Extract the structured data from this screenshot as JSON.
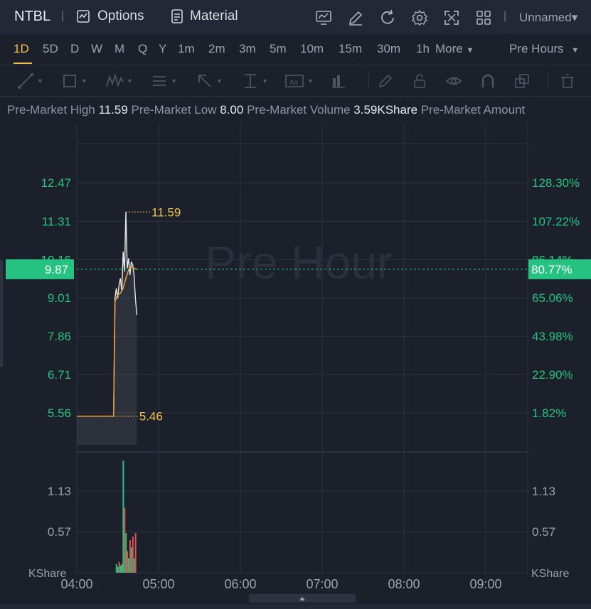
{
  "header": {
    "symbol": "NTBL",
    "separator": "|",
    "options_label": "Options",
    "material_label": "Material",
    "workspace_label": "Unnamed",
    "caret": "▾"
  },
  "periods": {
    "items": [
      "1D",
      "5D",
      "D",
      "W",
      "M",
      "Q",
      "Y",
      "1m",
      "2m",
      "3m",
      "5m",
      "10m",
      "15m",
      "30m",
      "1h"
    ],
    "active": "1D",
    "more_label": "More",
    "session_label": "Pre Hours"
  },
  "info": {
    "high_label": "Pre-Market High",
    "high_value": "11.59",
    "low_label": "Pre-Market Low",
    "low_value": "8.00",
    "volume_label": "Pre-Market Volume",
    "volume_value": "3.59KShare",
    "amount_label": "Pre-Market Amount"
  },
  "chart": {
    "watermark": "Pre Hour",
    "current_price": "9.87",
    "current_pct": "80.77%",
    "hidden_tick_left": "10.16",
    "hidden_tick_right": "86.14%",
    "high_marker": "11.59",
    "low_marker": "5.46",
    "volume_unit": "KShare"
  },
  "colors": {
    "up": "#26c281",
    "down": "#e0524f",
    "accent": "#f2c14a",
    "avg_line": "#e89a3c",
    "price_line": "#e6e6e6",
    "grid": "#2d3340"
  },
  "chart_data": {
    "type": "line",
    "x_ticks": [
      "04:00",
      "05:00",
      "06:00",
      "07:00",
      "08:00",
      "09:00"
    ],
    "price_axis": {
      "ticks": [
        12.47,
        11.31,
        10.16,
        9.01,
        7.86,
        6.71,
        5.56
      ],
      "tick_labels": [
        "12.47",
        "11.31",
        "10.16",
        "9.01",
        "7.86",
        "6.71",
        "5.56"
      ],
      "pct_labels": [
        "128.30%",
        "107.22%",
        "86.14%",
        "65.06%",
        "43.98%",
        "22.90%",
        "1.82%"
      ]
    },
    "volume_axis": {
      "ticks": [
        1.13,
        0.57
      ],
      "tick_labels": [
        "1.13",
        "0.57"
      ],
      "unit": "KShare"
    },
    "price_series": {
      "time": [
        "04:00",
        "04:20",
        "04:27",
        "04:28",
        "04:29",
        "04:30",
        "04:31",
        "04:32",
        "04:33",
        "04:34",
        "04:35",
        "04:36",
        "04:37",
        "04:38",
        "04:39",
        "04:40",
        "04:41",
        "04:42",
        "04:43",
        "04:44"
      ],
      "price": [
        5.46,
        5.46,
        5.46,
        9.0,
        9.3,
        9.0,
        9.4,
        9.6,
        9.2,
        10.4,
        9.8,
        11.59,
        9.9,
        10.2,
        9.7,
        10.1,
        10.0,
        9.7,
        9.0,
        8.5
      ]
    },
    "avg_series": {
      "time": [
        "04:00",
        "04:20",
        "04:27",
        "04:28",
        "04:30",
        "04:32",
        "04:34",
        "04:36",
        "04:38",
        "04:40",
        "04:42",
        "04:44"
      ],
      "price": [
        5.46,
        5.46,
        5.46,
        8.9,
        9.1,
        9.15,
        9.3,
        9.6,
        9.85,
        9.95,
        9.9,
        9.87
      ]
    },
    "volume_series": {
      "time": [
        "04:29",
        "04:30",
        "04:31",
        "04:32",
        "04:33",
        "04:34",
        "04:35",
        "04:36",
        "04:37",
        "04:38",
        "04:39",
        "04:40",
        "04:41",
        "04:42",
        "04:43"
      ],
      "value": [
        0.12,
        0.08,
        0.15,
        0.1,
        0.12,
        1.55,
        0.9,
        0.55,
        0.3,
        0.2,
        0.45,
        0.35,
        0.5,
        0.2,
        0.55
      ],
      "direction": [
        "up",
        "up",
        "down",
        "up",
        "up",
        "up",
        "down",
        "up",
        "down",
        "up",
        "down",
        "up",
        "down",
        "up",
        "down"
      ]
    }
  }
}
